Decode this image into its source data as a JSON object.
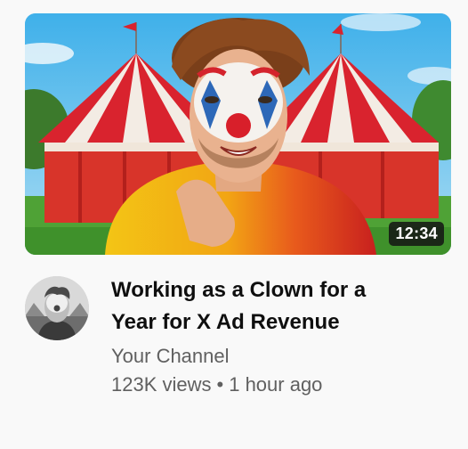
{
  "video": {
    "duration": "12:34",
    "title_line1": "Working as a Clown for a",
    "title_line2": "Year for X Ad Revenue",
    "channel": "Your Channel",
    "views": "123K views",
    "separator": "•",
    "age": "1 hour ago"
  },
  "colors": {
    "background": "#f9f9f9",
    "title": "#0f0f0f",
    "secondary_text": "#606060",
    "duration_badge": "#141414"
  },
  "icons": {
    "thumbnail": "clown-circus-thumbnail-image",
    "avatar": "channel-avatar-image"
  }
}
